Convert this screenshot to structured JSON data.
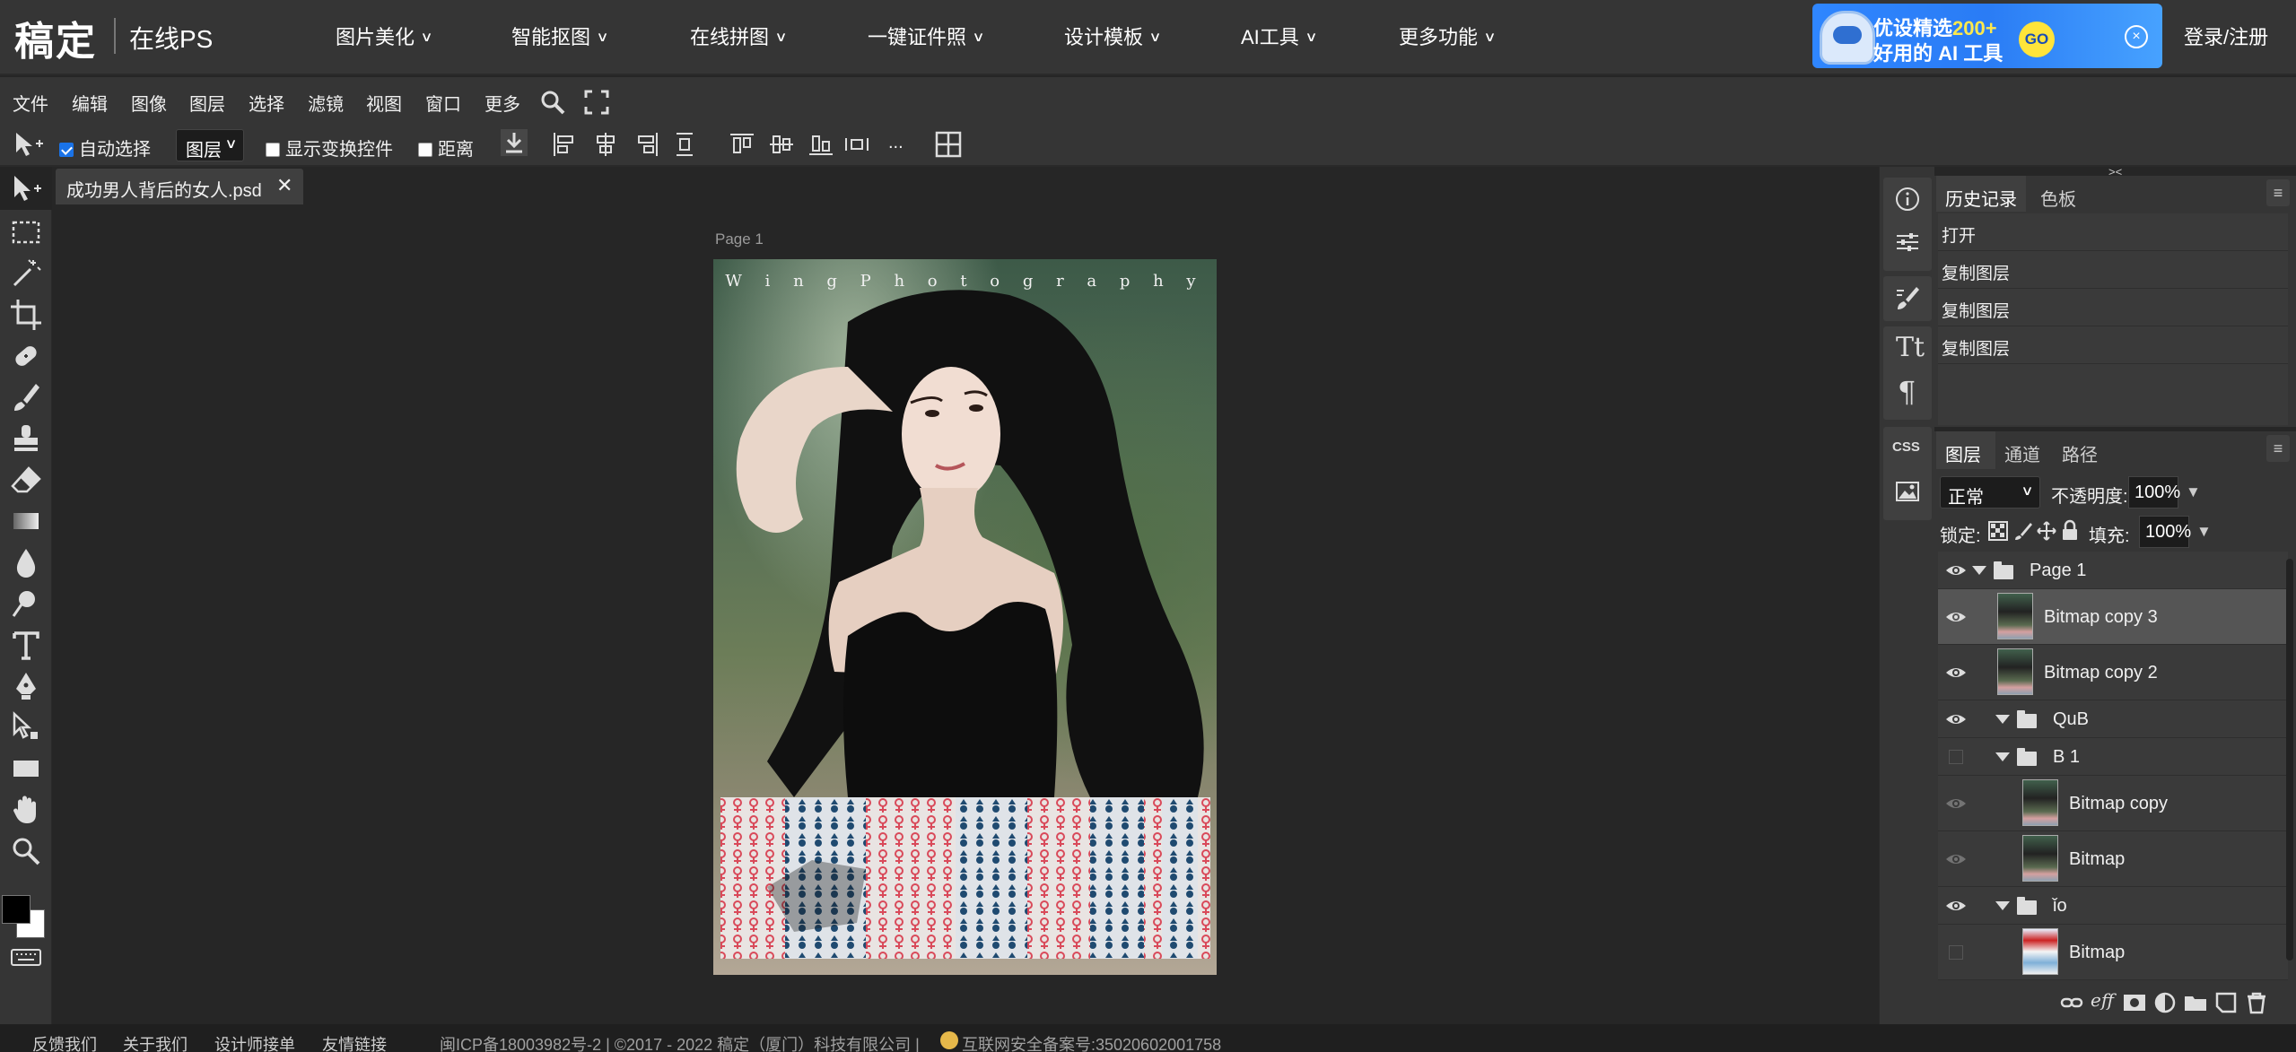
{
  "brand": {
    "logo": "稿定",
    "product": "在线PS"
  },
  "nav": [
    {
      "label": "图片美化"
    },
    {
      "label": "智能抠图"
    },
    {
      "label": "在线拼图"
    },
    {
      "label": "一键证件照"
    },
    {
      "label": "设计模板"
    },
    {
      "label": "AI工具"
    },
    {
      "label": "更多功能"
    }
  ],
  "ad": {
    "line1_prefix": "优设精选",
    "line1_highlight": "200+",
    "line2": "好用的 AI 工具",
    "go": "GO",
    "close": "×"
  },
  "login": "登录/注册",
  "menu": [
    "文件",
    "编辑",
    "图像",
    "图层",
    "选择",
    "滤镜",
    "视图",
    "窗口",
    "更多"
  ],
  "options": {
    "auto_select": "自动选择",
    "auto_select_checked": true,
    "layer_mode": "图层",
    "show_transform": "显示变换控件",
    "distance": "距离",
    "more": "..."
  },
  "document": {
    "tab": "成功男人背后的女人.psd",
    "page_label": "Page 1",
    "photo_title": "W i n g P h o t o g r a p h y"
  },
  "history_panel": {
    "tabs": [
      "历史记录",
      "色板"
    ],
    "items": [
      "打开",
      "复制图层",
      "复制图层",
      "复制图层"
    ]
  },
  "layers_panel": {
    "tabs": [
      "图层",
      "通道",
      "路径"
    ],
    "blend_mode": "正常",
    "opacity_label": "不透明度:",
    "opacity": "100%",
    "lock_label": "锁定:",
    "fill_label": "填充:",
    "fill": "100%",
    "layers": [
      {
        "name": "Page 1",
        "kind": "group",
        "visible": true
      },
      {
        "name": "Bitmap copy 3",
        "kind": "bitmap",
        "visible": true,
        "selected": true
      },
      {
        "name": "Bitmap copy 2",
        "kind": "bitmap",
        "visible": true
      },
      {
        "name": "QuB",
        "kind": "group",
        "visible": true
      },
      {
        "name": "B 1",
        "kind": "group",
        "visible": false
      },
      {
        "name": "Bitmap copy",
        "kind": "bitmap",
        "visible": "dim"
      },
      {
        "name": "Bitmap",
        "kind": "bitmap",
        "visible": "dim"
      },
      {
        "name": "ǐo",
        "kind": "group",
        "visible": true
      },
      {
        "name": "Bitmap",
        "kind": "bitmap",
        "visible": false
      }
    ]
  },
  "footer": {
    "links": [
      "反馈我们",
      "关于我们",
      "设计师接单",
      "友情链接"
    ],
    "info": "闽ICP备18003982号-2 | ©2017 - 2022 稿定（厦门）科技有限公司 |",
    "police": "互联网安全备案号:35020602001758"
  },
  "colors": {
    "accent": "#1a73e8",
    "panel": "#353535",
    "workspace": "#262626"
  }
}
